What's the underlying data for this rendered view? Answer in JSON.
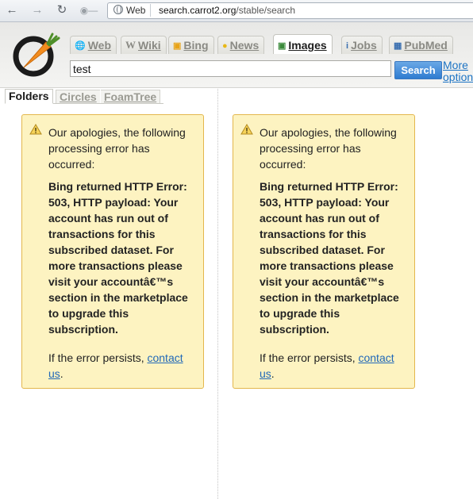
{
  "browser": {
    "site_chip": "Web",
    "url_host": "search.carrot2.org",
    "url_path": "/stable/search"
  },
  "app": {
    "sources": [
      {
        "label": "Web",
        "icon": "globe-icon",
        "active": false
      },
      {
        "label": "Wiki",
        "icon": "wikipedia-icon",
        "active": false
      },
      {
        "label": "Bing",
        "icon": "bing-icon",
        "active": false
      },
      {
        "label": "News",
        "icon": "news-icon",
        "active": false
      },
      {
        "label": "Images",
        "icon": "images-icon",
        "active": true
      },
      {
        "label": "Jobs",
        "icon": "jobs-icon",
        "active": false
      },
      {
        "label": "PubMed",
        "icon": "pubmed-icon",
        "active": false
      }
    ],
    "query": "test",
    "search_button": "Search",
    "more_options": "More options"
  },
  "views": {
    "tabs": [
      "Folders",
      "Circles",
      "FoamTree"
    ],
    "active": "Folders"
  },
  "error": {
    "intro": "Our apologies, the following processing error has occurred:",
    "detail": "Bing returned HTTP Error: 503, HTTP payload: Your account has run out of transactions for this subscribed dataset. For more transactions please visit your accountâ€™s section in the marketplace to upgrade this subscription.",
    "footer_prefix": "If the error persists, ",
    "footer_link": "contact us",
    "footer_suffix": "."
  },
  "colors": {
    "error_bg": "#fdf3c1",
    "error_border": "#e3b74d",
    "link": "#2068b8",
    "search_button": "#2f7cd0",
    "logo_orange": "#f28c1e"
  }
}
